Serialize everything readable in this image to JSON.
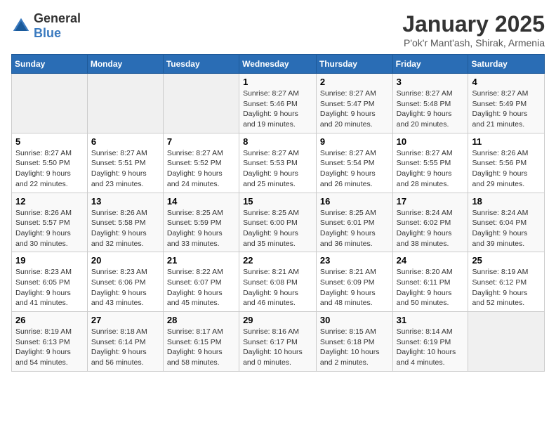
{
  "logo": {
    "general": "General",
    "blue": "Blue"
  },
  "title": "January 2025",
  "subtitle": "P'ok'r Mant'ash, Shirak, Armenia",
  "headers": [
    "Sunday",
    "Monday",
    "Tuesday",
    "Wednesday",
    "Thursday",
    "Friday",
    "Saturday"
  ],
  "weeks": [
    [
      {
        "day": "",
        "info": ""
      },
      {
        "day": "",
        "info": ""
      },
      {
        "day": "",
        "info": ""
      },
      {
        "day": "1",
        "info": "Sunrise: 8:27 AM\nSunset: 5:46 PM\nDaylight: 9 hours\nand 19 minutes."
      },
      {
        "day": "2",
        "info": "Sunrise: 8:27 AM\nSunset: 5:47 PM\nDaylight: 9 hours\nand 20 minutes."
      },
      {
        "day": "3",
        "info": "Sunrise: 8:27 AM\nSunset: 5:48 PM\nDaylight: 9 hours\nand 20 minutes."
      },
      {
        "day": "4",
        "info": "Sunrise: 8:27 AM\nSunset: 5:49 PM\nDaylight: 9 hours\nand 21 minutes."
      }
    ],
    [
      {
        "day": "5",
        "info": "Sunrise: 8:27 AM\nSunset: 5:50 PM\nDaylight: 9 hours\nand 22 minutes."
      },
      {
        "day": "6",
        "info": "Sunrise: 8:27 AM\nSunset: 5:51 PM\nDaylight: 9 hours\nand 23 minutes."
      },
      {
        "day": "7",
        "info": "Sunrise: 8:27 AM\nSunset: 5:52 PM\nDaylight: 9 hours\nand 24 minutes."
      },
      {
        "day": "8",
        "info": "Sunrise: 8:27 AM\nSunset: 5:53 PM\nDaylight: 9 hours\nand 25 minutes."
      },
      {
        "day": "9",
        "info": "Sunrise: 8:27 AM\nSunset: 5:54 PM\nDaylight: 9 hours\nand 26 minutes."
      },
      {
        "day": "10",
        "info": "Sunrise: 8:27 AM\nSunset: 5:55 PM\nDaylight: 9 hours\nand 28 minutes."
      },
      {
        "day": "11",
        "info": "Sunrise: 8:26 AM\nSunset: 5:56 PM\nDaylight: 9 hours\nand 29 minutes."
      }
    ],
    [
      {
        "day": "12",
        "info": "Sunrise: 8:26 AM\nSunset: 5:57 PM\nDaylight: 9 hours\nand 30 minutes."
      },
      {
        "day": "13",
        "info": "Sunrise: 8:26 AM\nSunset: 5:58 PM\nDaylight: 9 hours\nand 32 minutes."
      },
      {
        "day": "14",
        "info": "Sunrise: 8:25 AM\nSunset: 5:59 PM\nDaylight: 9 hours\nand 33 minutes."
      },
      {
        "day": "15",
        "info": "Sunrise: 8:25 AM\nSunset: 6:00 PM\nDaylight: 9 hours\nand 35 minutes."
      },
      {
        "day": "16",
        "info": "Sunrise: 8:25 AM\nSunset: 6:01 PM\nDaylight: 9 hours\nand 36 minutes."
      },
      {
        "day": "17",
        "info": "Sunrise: 8:24 AM\nSunset: 6:02 PM\nDaylight: 9 hours\nand 38 minutes."
      },
      {
        "day": "18",
        "info": "Sunrise: 8:24 AM\nSunset: 6:04 PM\nDaylight: 9 hours\nand 39 minutes."
      }
    ],
    [
      {
        "day": "19",
        "info": "Sunrise: 8:23 AM\nSunset: 6:05 PM\nDaylight: 9 hours\nand 41 minutes."
      },
      {
        "day": "20",
        "info": "Sunrise: 8:23 AM\nSunset: 6:06 PM\nDaylight: 9 hours\nand 43 minutes."
      },
      {
        "day": "21",
        "info": "Sunrise: 8:22 AM\nSunset: 6:07 PM\nDaylight: 9 hours\nand 45 minutes."
      },
      {
        "day": "22",
        "info": "Sunrise: 8:21 AM\nSunset: 6:08 PM\nDaylight: 9 hours\nand 46 minutes."
      },
      {
        "day": "23",
        "info": "Sunrise: 8:21 AM\nSunset: 6:09 PM\nDaylight: 9 hours\nand 48 minutes."
      },
      {
        "day": "24",
        "info": "Sunrise: 8:20 AM\nSunset: 6:11 PM\nDaylight: 9 hours\nand 50 minutes."
      },
      {
        "day": "25",
        "info": "Sunrise: 8:19 AM\nSunset: 6:12 PM\nDaylight: 9 hours\nand 52 minutes."
      }
    ],
    [
      {
        "day": "26",
        "info": "Sunrise: 8:19 AM\nSunset: 6:13 PM\nDaylight: 9 hours\nand 54 minutes."
      },
      {
        "day": "27",
        "info": "Sunrise: 8:18 AM\nSunset: 6:14 PM\nDaylight: 9 hours\nand 56 minutes."
      },
      {
        "day": "28",
        "info": "Sunrise: 8:17 AM\nSunset: 6:15 PM\nDaylight: 9 hours\nand 58 minutes."
      },
      {
        "day": "29",
        "info": "Sunrise: 8:16 AM\nSunset: 6:17 PM\nDaylight: 10 hours\nand 0 minutes."
      },
      {
        "day": "30",
        "info": "Sunrise: 8:15 AM\nSunset: 6:18 PM\nDaylight: 10 hours\nand 2 minutes."
      },
      {
        "day": "31",
        "info": "Sunrise: 8:14 AM\nSunset: 6:19 PM\nDaylight: 10 hours\nand 4 minutes."
      },
      {
        "day": "",
        "info": ""
      }
    ]
  ]
}
